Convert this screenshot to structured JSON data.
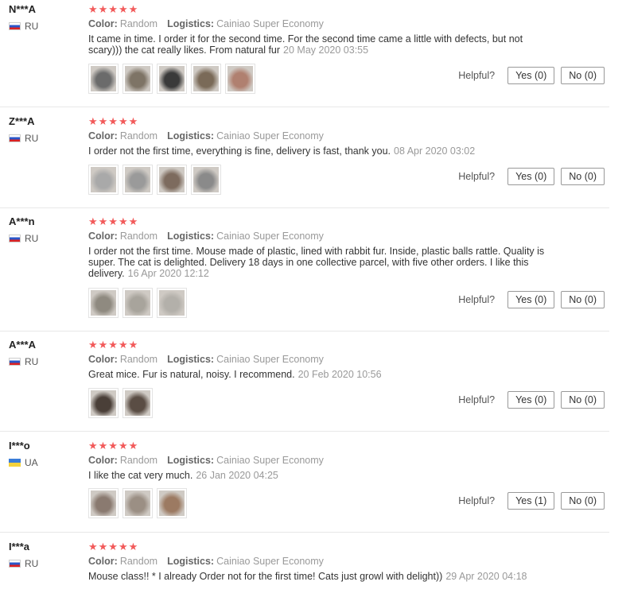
{
  "labels": {
    "color": "Color:",
    "logistics": "Logistics:",
    "helpful": "Helpful?"
  },
  "reviews": [
    {
      "user": "N***A",
      "country": "RU",
      "stars": "★★★★★",
      "color": "Random",
      "logistics": "Cainiao Super Economy",
      "text": "It came in time. I order it for the second time. For the second time came a little with defects, but not scary))) the cat really likes. From natural fur",
      "date": "20 May 2020 03:55",
      "yes": "Yes (0)",
      "no": "No (0)",
      "photo_colors": [
        "#6b6b6b",
        "#7e7466",
        "#3a3a3a",
        "#7a6a58",
        "#b08070"
      ]
    },
    {
      "user": "Z***A",
      "country": "RU",
      "stars": "★★★★★",
      "color": "Random",
      "logistics": "Cainiao Super Economy",
      "text": "I order not the first time, everything is fine, delivery is fast, thank you.",
      "date": "08 Apr 2020 03:02",
      "yes": "Yes (0)",
      "no": "No (0)",
      "photo_colors": [
        "#a9a9a9",
        "#9a9a9a",
        "#7d6b5e",
        "#8a8a8a"
      ]
    },
    {
      "user": "A***n",
      "country": "RU",
      "stars": "★★★★★",
      "color": "Random",
      "logistics": "Cainiao Super Economy",
      "text": "I order not the first time. Mouse made of plastic, lined with rabbit fur. Inside, plastic balls rattle. Quality is super. The cat is delighted. Delivery 18 days in one collective parcel, with five other orders. I like this delivery.",
      "date": "16 Apr 2020 12:12",
      "yes": "Yes (0)",
      "no": "No (0)",
      "photo_colors": [
        "#8f8a80",
        "#a8a49c",
        "#b3b0aa"
      ]
    },
    {
      "user": "A***A",
      "country": "RU",
      "stars": "★★★★★",
      "color": "Random",
      "logistics": "Cainiao Super Economy",
      "text": "Great mice. Fur is natural, noisy. I recommend.",
      "date": "20 Feb 2020 10:56",
      "yes": "Yes (0)",
      "no": "No (0)",
      "photo_colors": [
        "#4a3f38",
        "#5a4d44"
      ]
    },
    {
      "user": "I***o",
      "country": "UA",
      "stars": "★★★★★",
      "color": "Random",
      "logistics": "Cainiao Super Economy",
      "text": "I like the cat very much.",
      "date": "26 Jan 2020 04:25",
      "yes": "Yes (1)",
      "no": "No (0)",
      "photo_colors": [
        "#8a7a70",
        "#9b8f84",
        "#9c7a62"
      ]
    },
    {
      "user": "I***a",
      "country": "RU",
      "stars": "★★★★★",
      "color": "Random",
      "logistics": "Cainiao Super Economy",
      "text": "Mouse class!! * I already Order not for the first time! Cats just growl with delight))",
      "date": "29 Apr 2020 04:18"
    }
  ]
}
